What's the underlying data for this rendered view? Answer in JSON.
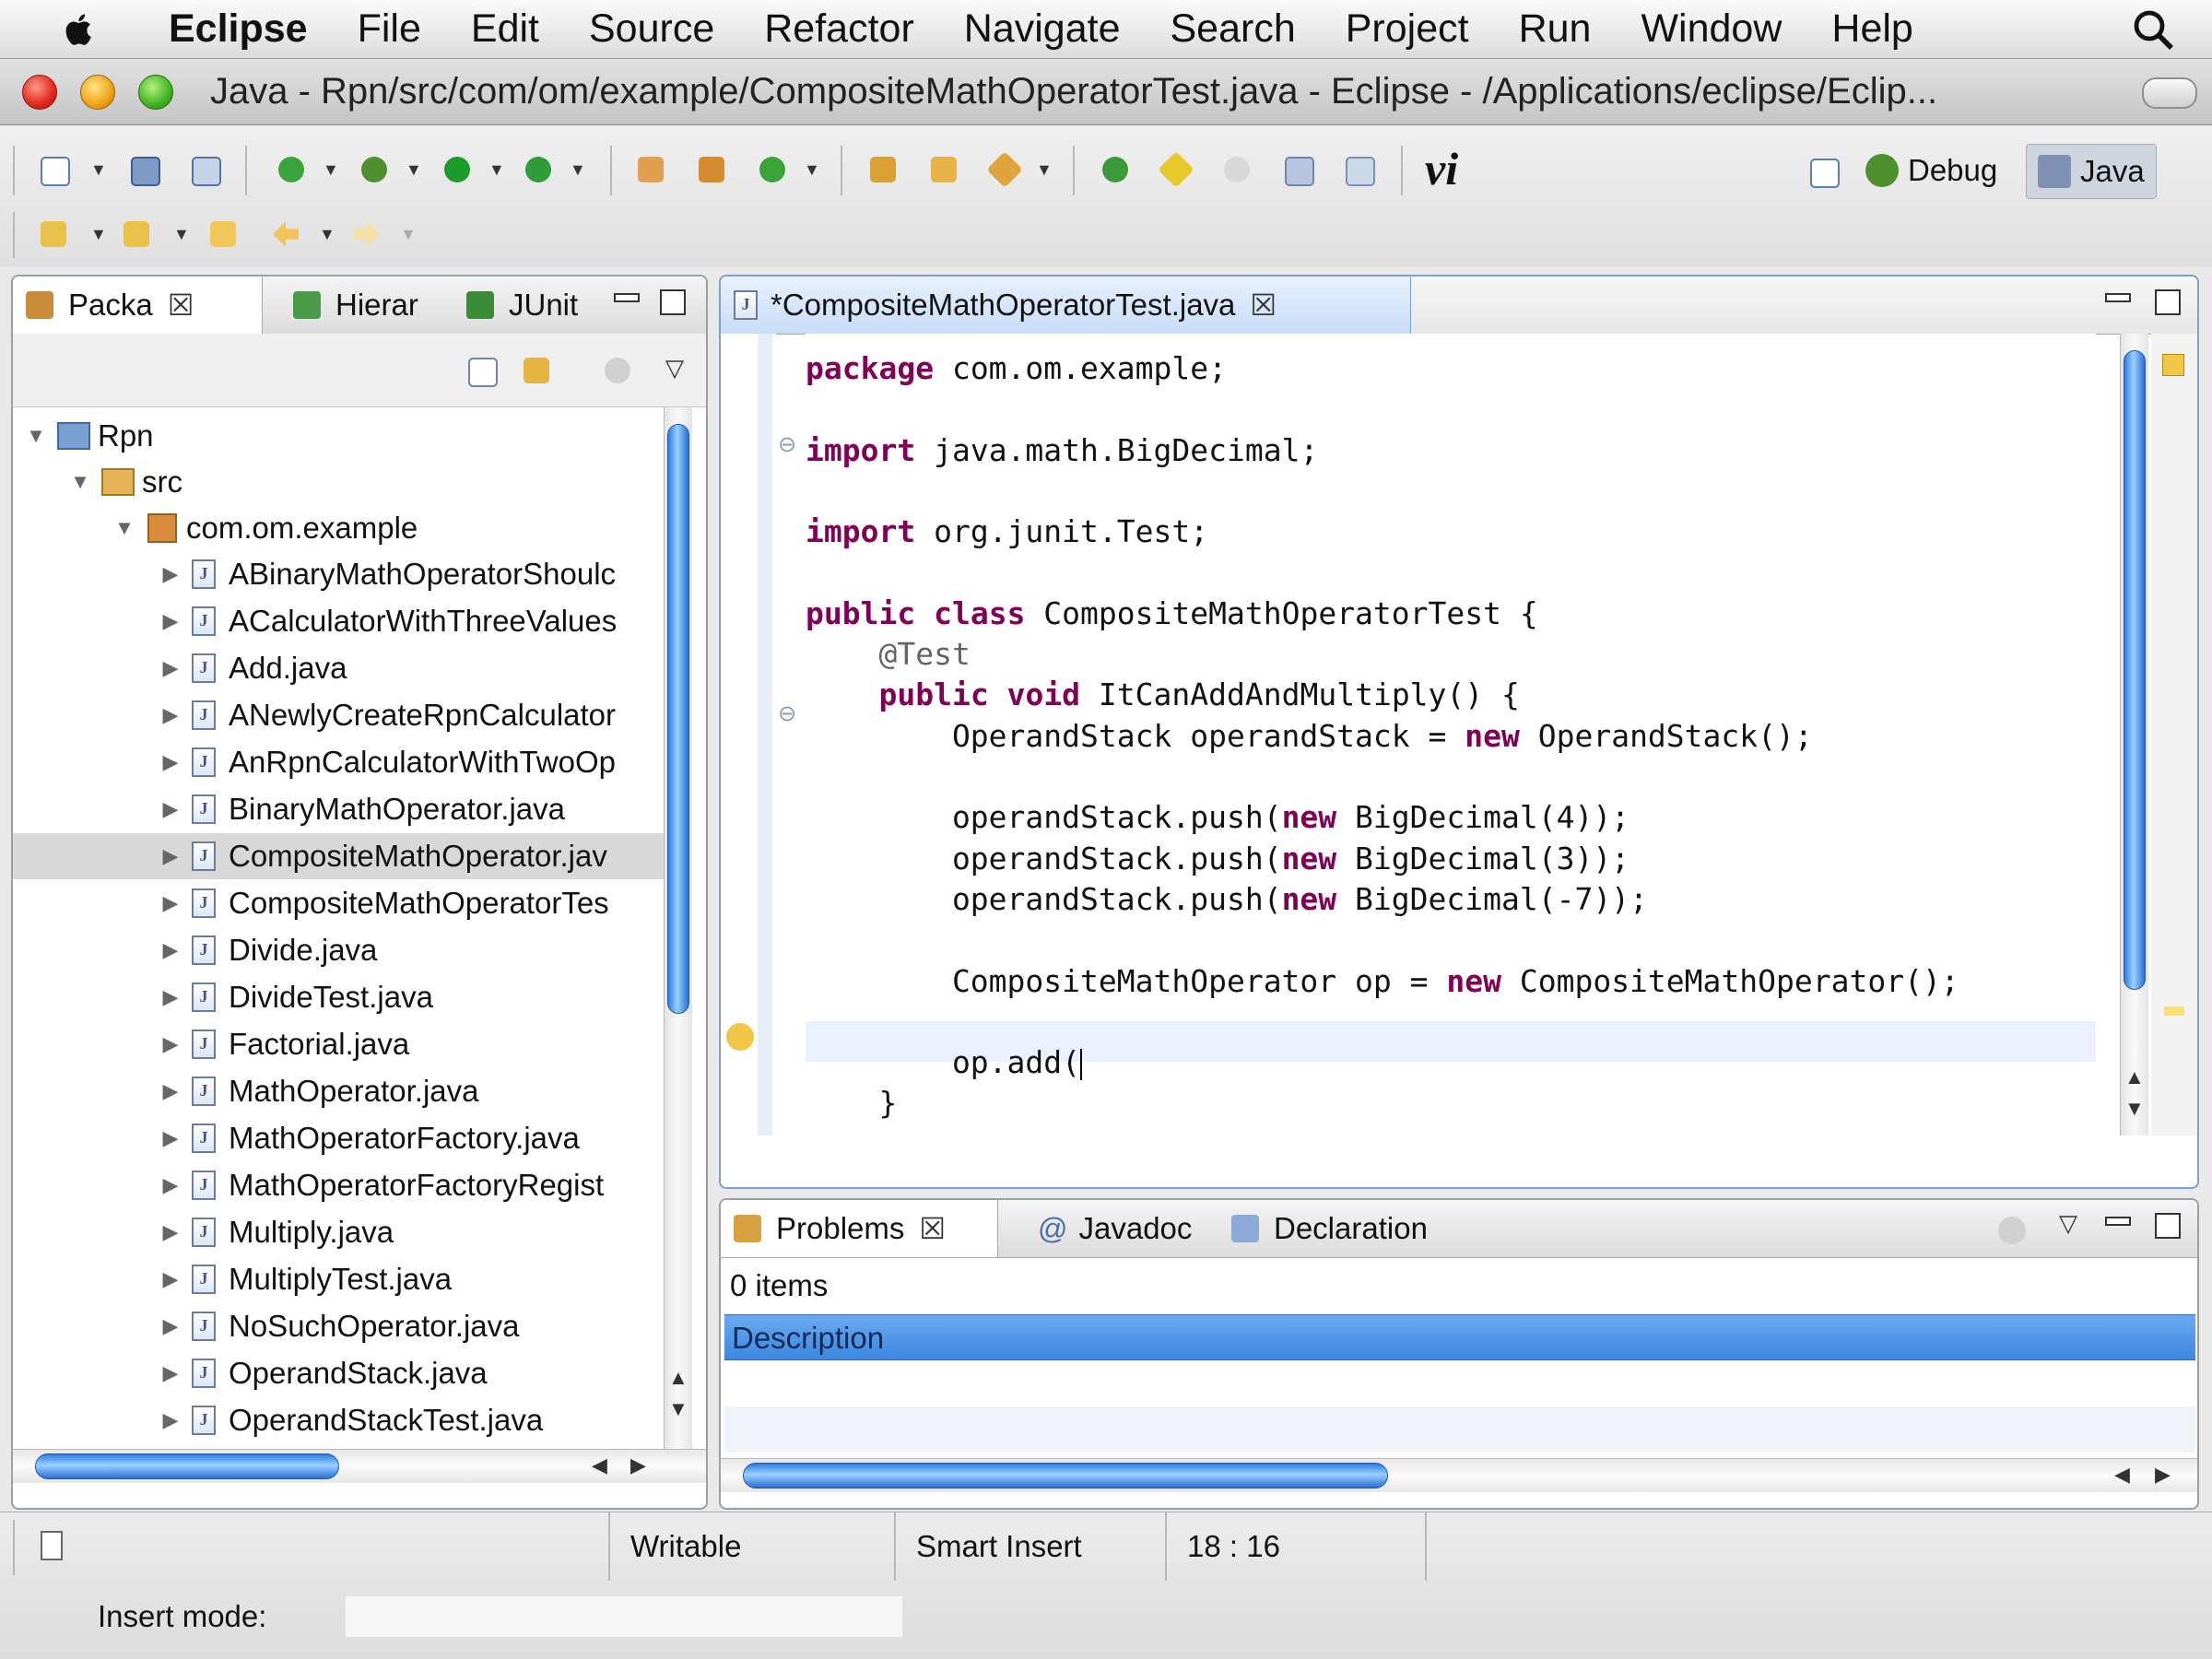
{
  "menubar": {
    "items": [
      "Eclipse",
      "File",
      "Edit",
      "Source",
      "Refactor",
      "Navigate",
      "Search",
      "Project",
      "Run",
      "Window",
      "Help"
    ]
  },
  "window": {
    "title": "Java - Rpn/src/com/om/example/CompositeMathOperatorTest.java - Eclipse - /Applications/eclipse/Eclip..."
  },
  "toolbar": {
    "perspectives": [
      "Debug",
      "Java"
    ],
    "vi_label": "vi"
  },
  "left_panel": {
    "tabs": [
      "Packa",
      "Hierar",
      "JUnit"
    ],
    "tree": {
      "project": "Rpn",
      "folder": "src",
      "package": "com.om.example",
      "files": [
        "ABinaryMathOperatorShoulc",
        "ACalculatorWithThreeValues",
        "Add.java",
        "ANewlyCreateRpnCalculator",
        "AnRpnCalculatorWithTwoOp",
        "BinaryMathOperator.java",
        "CompositeMathOperator.jav",
        "CompositeMathOperatorTes",
        "Divide.java",
        "DivideTest.java",
        "Factorial.java",
        "MathOperator.java",
        "MathOperatorFactory.java",
        "MathOperatorFactoryRegist",
        "Multiply.java",
        "MultiplyTest.java",
        "NoSuchOperator.java",
        "OperandStack.java",
        "OperandStackTest.java"
      ],
      "selected_index": 6
    }
  },
  "editor": {
    "tab_label": "*CompositeMathOperatorTest.java",
    "lines": [
      [
        {
          "t": "package",
          "k": "kw"
        },
        {
          "t": " com.om.example;"
        }
      ],
      [],
      [
        {
          "t": "import",
          "k": "kw"
        },
        {
          "t": " java.math.BigDecimal;"
        }
      ],
      [],
      [
        {
          "t": "import",
          "k": "kw"
        },
        {
          "t": " org.junit.Test;"
        }
      ],
      [],
      [
        {
          "t": "public",
          "k": "kw"
        },
        {
          "t": " "
        },
        {
          "t": "class",
          "k": "kw"
        },
        {
          "t": " CompositeMathOperatorTest {"
        }
      ],
      [
        {
          "t": "    "
        },
        {
          "t": "@Test",
          "k": "ann"
        }
      ],
      [
        {
          "t": "    "
        },
        {
          "t": "public",
          "k": "kw"
        },
        {
          "t": " "
        },
        {
          "t": "void",
          "k": "kw"
        },
        {
          "t": " ItCanAddAndMultiply() {"
        }
      ],
      [
        {
          "t": "        OperandStack operandStack = "
        },
        {
          "t": "new",
          "k": "kw"
        },
        {
          "t": " OperandStack();"
        }
      ],
      [],
      [
        {
          "t": "        operandStack.push("
        },
        {
          "t": "new",
          "k": "kw"
        },
        {
          "t": " BigDecimal(4));"
        }
      ],
      [
        {
          "t": "        operandStack.push("
        },
        {
          "t": "new",
          "k": "kw"
        },
        {
          "t": " BigDecimal(3));"
        }
      ],
      [
        {
          "t": "        operandStack.push("
        },
        {
          "t": "new",
          "k": "kw"
        },
        {
          "t": " BigDecimal(-7));"
        }
      ],
      [],
      [
        {
          "t": "        CompositeMathOperator op = "
        },
        {
          "t": "new",
          "k": "kw"
        },
        {
          "t": " CompositeMathOperator();"
        }
      ],
      [],
      [
        {
          "t": "        op.add("
        }
      ],
      [
        {
          "t": "    }"
        }
      ]
    ]
  },
  "bottom_panel": {
    "tabs": [
      "Problems",
      "Javadoc",
      "Declaration"
    ],
    "summary": "0 items",
    "column_header": "Description"
  },
  "status_bar": {
    "writable": "Writable",
    "insert": "Smart Insert",
    "position": "18 : 16",
    "insert_mode_label": "Insert mode:"
  },
  "colors": {
    "keyword": "#7f0055",
    "annotation": "#646464",
    "selection": "#d8d8d8",
    "header_blue": "#4a90e2"
  }
}
